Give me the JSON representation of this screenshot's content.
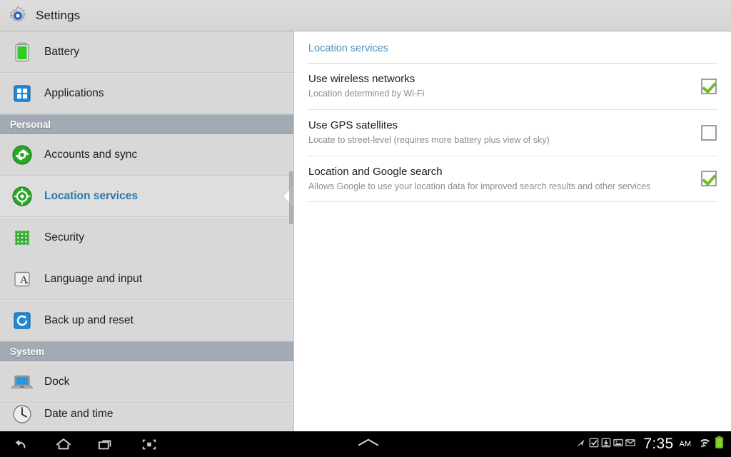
{
  "titlebar": {
    "title": "Settings",
    "icon": "settings-gear-icon"
  },
  "sidebar": {
    "items": [
      {
        "type": "item",
        "label": "Battery",
        "icon": "battery-icon",
        "selected": false
      },
      {
        "type": "item",
        "label": "Applications",
        "icon": "applications-icon",
        "selected": false
      },
      {
        "type": "header",
        "label": "Personal"
      },
      {
        "type": "item",
        "label": "Accounts and sync",
        "icon": "sync-icon",
        "selected": false
      },
      {
        "type": "item",
        "label": "Location services",
        "icon": "location-icon",
        "selected": true
      },
      {
        "type": "item",
        "label": "Security",
        "icon": "security-icon",
        "selected": false
      },
      {
        "type": "item",
        "label": "Language and input",
        "icon": "language-icon",
        "selected": false
      },
      {
        "type": "item",
        "label": "Back up and reset",
        "icon": "backup-reset-icon",
        "selected": false
      },
      {
        "type": "header",
        "label": "System"
      },
      {
        "type": "item",
        "label": "Dock",
        "icon": "dock-icon",
        "selected": false
      },
      {
        "type": "item",
        "label": "Date and time",
        "icon": "clock-icon",
        "selected": false,
        "partial": true
      }
    ]
  },
  "content": {
    "title": "Location services",
    "rows": [
      {
        "title": "Use wireless networks",
        "subtitle": "Location determined by Wi-Fi",
        "checked": true
      },
      {
        "title": "Use GPS satellites",
        "subtitle": "Locate to street-level (requires more battery plus view of sky)",
        "checked": false
      },
      {
        "title": "Location and Google search",
        "subtitle": "Allows Google to use your location data for improved search results and other services",
        "checked": true
      }
    ]
  },
  "systembar": {
    "nav_keys": [
      {
        "name": "back-button",
        "icon": "back-arrow-icon"
      },
      {
        "name": "home-button",
        "icon": "home-icon"
      },
      {
        "name": "recent-apps-button",
        "icon": "recent-apps-icon"
      },
      {
        "name": "screenshot-button",
        "icon": "screen-capture-icon"
      }
    ],
    "center_handle": "show-notifications-chevron-icon",
    "status_icons": [
      "location-active-icon",
      "task-checkbox-icon",
      "download-icon",
      "screenshot-captured-icon",
      "email-icon"
    ],
    "clock": "7:35",
    "ampm": "AM",
    "wifi_icon": "wifi-signal-icon",
    "battery_icon": "battery-full-icon"
  },
  "colors": {
    "accent_blue": "#2b78a8",
    "title_blue": "#4a90b8",
    "section_header": "#a2abb4",
    "check_green": "#76b82a",
    "sidebar_bg": "#d8d8d8"
  }
}
